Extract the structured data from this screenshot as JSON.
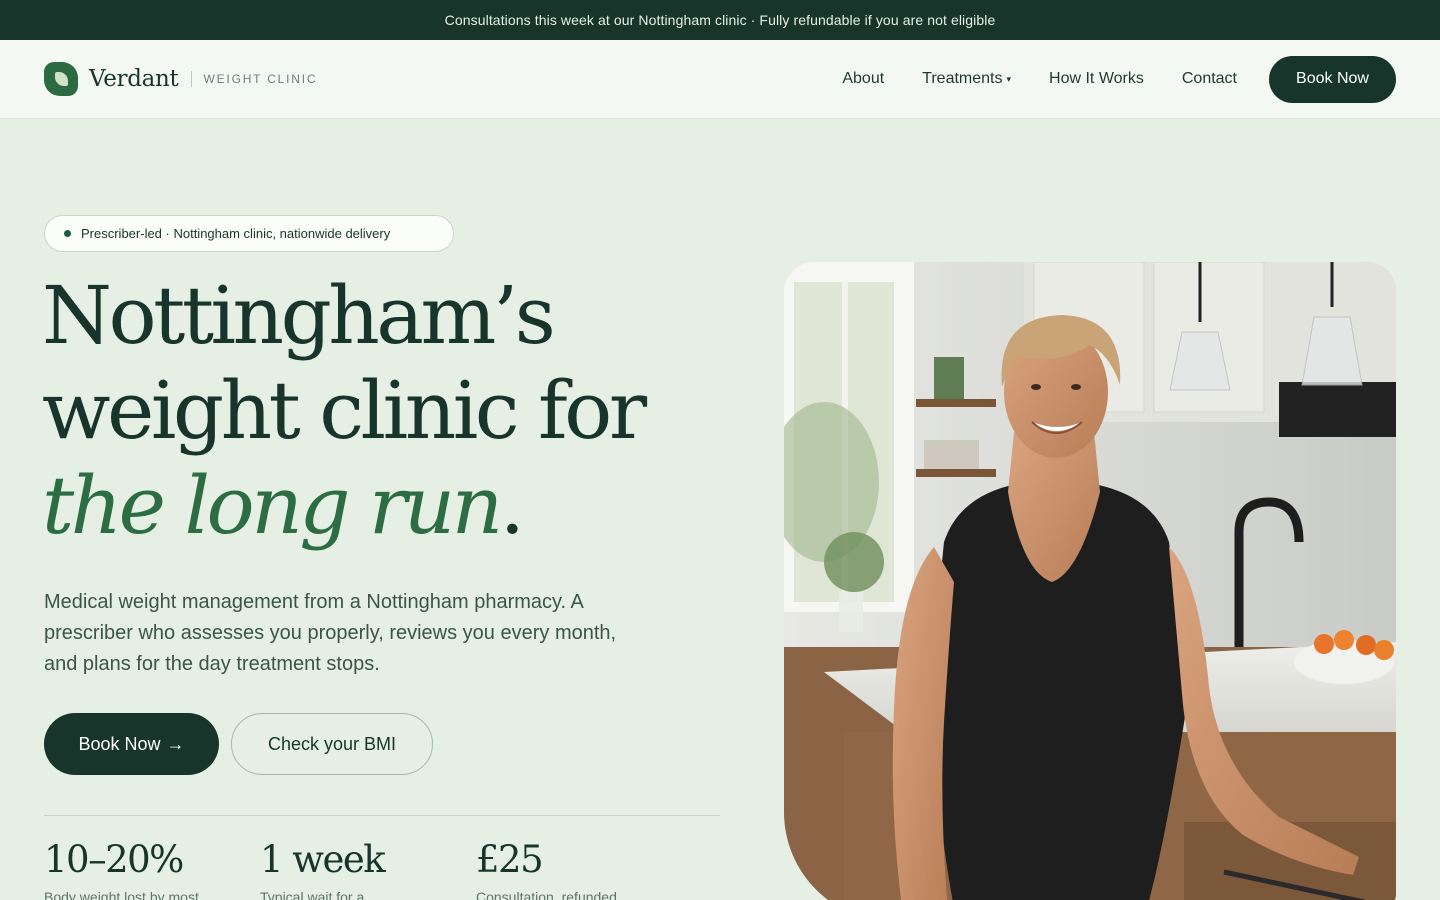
{
  "announcement": "Consultations this week at our Nottingham clinic · Fully refundable if you are not eligible",
  "brand": {
    "name": "Verdant",
    "tagline": "WEIGHT CLINIC"
  },
  "nav": {
    "items": [
      {
        "label": "About"
      },
      {
        "label": "Treatments",
        "has_dropdown": true
      },
      {
        "label": "How It Works"
      },
      {
        "label": "Contact"
      }
    ],
    "cta": "Book Now",
    "dropdown_glyph": "▾"
  },
  "hero": {
    "pill": "Prescriber-led · Nottingham clinic, nationwide delivery",
    "headline": {
      "line1": "Nottingham’s",
      "line2": "weight clinic for",
      "accent": "the long run",
      "period": "."
    },
    "lede": "Medical weight management from a Nottingham pharmacy. A prescriber who assesses you properly, reviews you every month, and plans for the day treatment stops.",
    "primary_cta": "Book Now",
    "primary_cta_arrow": "→",
    "secondary_cta": "Check your BMI",
    "image_subject": "Smiling woman in black tank top leaning on a kitchen counter"
  },
  "stats": [
    {
      "value": "10–20%",
      "label": "Body weight lost by most"
    },
    {
      "value": "1 week",
      "label": "Typical wait for a"
    },
    {
      "value": "£25",
      "label": "Consultation, refunded"
    }
  ],
  "colors": {
    "dark_green": "#17352a",
    "accent_green": "#2c6d44",
    "page_bg": "#e6efe3",
    "header_bg": "#f4f8f2"
  }
}
